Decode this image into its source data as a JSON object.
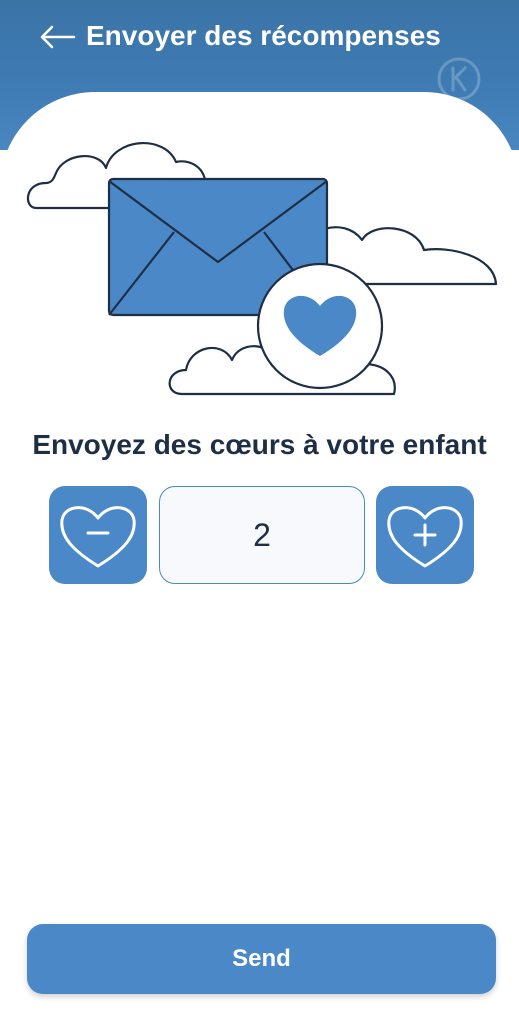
{
  "header": {
    "title": "Envoyer des récompenses",
    "back_icon": "arrow-left-icon",
    "brand_icon": "k-logo-icon"
  },
  "illustration": {
    "icons": [
      "cloud-icon",
      "envelope-icon",
      "heart-icon"
    ],
    "accent_color": "#4a88c7",
    "outline_color": "#1e2f45"
  },
  "main": {
    "heading": "Envoyez des cœurs à votre enfant",
    "stepper": {
      "value": "2",
      "decrement_icon": "heart-minus-icon",
      "increment_icon": "heart-plus-icon"
    }
  },
  "footer": {
    "send_label": "Send"
  },
  "colors": {
    "header_bg": "#3f7cb5",
    "primary": "#4a88c7",
    "text": "#1e2f45",
    "background": "#ffffff"
  }
}
